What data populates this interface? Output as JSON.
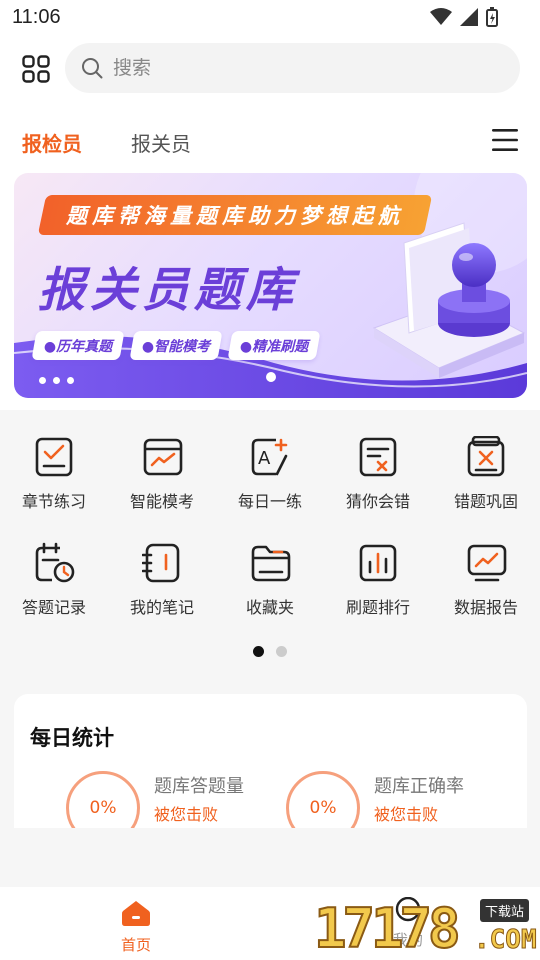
{
  "status_bar": {
    "time": "11:06"
  },
  "search": {
    "placeholder": "搜索"
  },
  "tabs": [
    {
      "label": "报检员",
      "active": true
    },
    {
      "label": "报关员",
      "active": false
    }
  ],
  "banner": {
    "tagline": "题库帮海量题库助力梦想起航",
    "title": "报关员题库",
    "chips": [
      "●历年真题",
      "●智能模考",
      "●精准刷题"
    ]
  },
  "features": [
    {
      "label": "章节练习",
      "icon": "chapter-practice-icon"
    },
    {
      "label": "智能模考",
      "icon": "smart-exam-icon"
    },
    {
      "label": "每日一练",
      "icon": "daily-practice-icon"
    },
    {
      "label": "猜你会错",
      "icon": "guess-wrong-icon"
    },
    {
      "label": "错题巩固",
      "icon": "wrong-review-icon"
    },
    {
      "label": "答题记录",
      "icon": "answer-record-icon"
    },
    {
      "label": "我的笔记",
      "icon": "notes-icon"
    },
    {
      "label": "收藏夹",
      "icon": "favorites-folder-icon"
    },
    {
      "label": "刷题排行",
      "icon": "ranking-icon"
    },
    {
      "label": "数据报告",
      "icon": "data-report-icon"
    }
  ],
  "daily_stats": {
    "title": "每日统计",
    "items": [
      {
        "value": "0%",
        "label": "题库答题量",
        "sub": "被您击败"
      },
      {
        "value": "0%",
        "label": "题库正确率",
        "sub": "被您击败"
      }
    ]
  },
  "bottom_nav": {
    "home_label": "首页",
    "second_label": "我的"
  },
  "watermark": {
    "number": "17178",
    "badge": "下载站",
    "suffix": ".COM"
  },
  "colors": {
    "accent": "#f0611f",
    "banner_purple": "#6b3fd8"
  }
}
